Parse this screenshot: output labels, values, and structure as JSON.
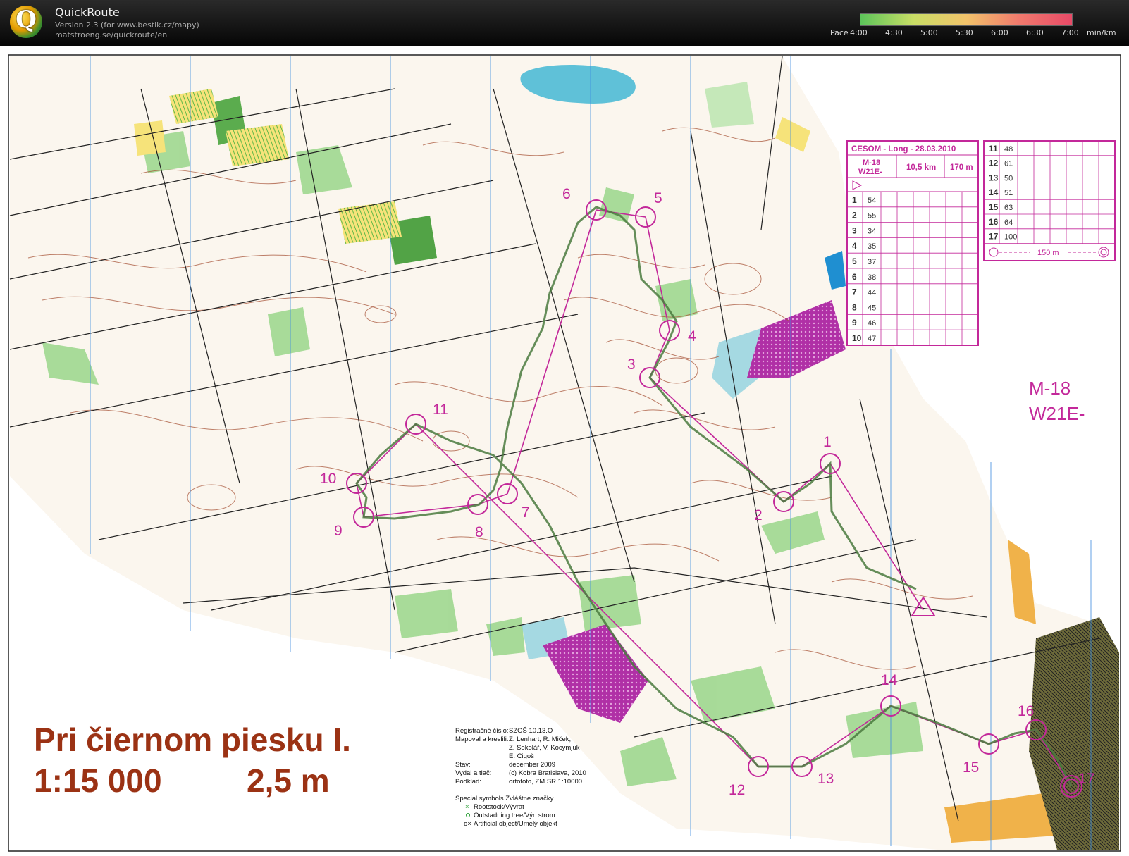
{
  "app": {
    "title": "QuickRoute",
    "version": "Version 2.3  (for www.bestik.cz/mapy)",
    "site": "matstroeng.se/quickroute/en",
    "logo_letter": "Q"
  },
  "pace_legend": {
    "prefix": "Pace",
    "ticks": [
      "4:00",
      "4:30",
      "5:00",
      "5:30",
      "6:00",
      "6:30",
      "7:00"
    ],
    "unit": "min/km",
    "values": [
      4.0,
      4.5,
      5.0,
      5.5,
      6.0,
      6.5,
      7.0
    ],
    "colors": [
      "#5cc45a",
      "#c9de66",
      "#f2c36b",
      "#f07a6d",
      "#e84a67"
    ]
  },
  "map": {
    "title": "Pri čiernom piesku I.",
    "scale": "1:15 000",
    "contour": "2,5 m",
    "course_class_line1": "M-18",
    "course_class_line2": "W21E-",
    "colors": {
      "course": "#c3289a",
      "route": "#4a7a3e",
      "contour": "#a8553a",
      "water": "#5fc1d8",
      "vegetation": "#5fb848",
      "open": "#f6e37a",
      "purple": "#b030a6",
      "grid": "#3d8ce0"
    }
  },
  "control_descriptions": {
    "header": "CESOM - Long - 28.03.2010",
    "class_1": "M-18",
    "class_2": "W21E-",
    "length": "10,5 km",
    "climb": "170 m",
    "rows": [
      {
        "num": "1",
        "code": "54"
      },
      {
        "num": "2",
        "code": "55"
      },
      {
        "num": "3",
        "code": "34"
      },
      {
        "num": "4",
        "code": "35"
      },
      {
        "num": "5",
        "code": "37"
      },
      {
        "num": "6",
        "code": "38"
      },
      {
        "num": "7",
        "code": "44"
      },
      {
        "num": "8",
        "code": "45"
      },
      {
        "num": "9",
        "code": "46"
      },
      {
        "num": "10",
        "code": "47"
      },
      {
        "num": "11",
        "code": "48"
      },
      {
        "num": "12",
        "code": "61"
      },
      {
        "num": "13",
        "code": "50"
      },
      {
        "num": "14",
        "code": "51"
      },
      {
        "num": "15",
        "code": "63"
      },
      {
        "num": "16",
        "code": "64"
      },
      {
        "num": "17",
        "code": "100"
      }
    ],
    "finish_distance": "150 m"
  },
  "imprint": {
    "lines": [
      {
        "label": "Registračné číslo:",
        "value": "SZOŠ 10.13.O"
      },
      {
        "label": "Mapoval a kreslili:",
        "value": "Z. Lenhart, R. Miček,"
      },
      {
        "label": "",
        "value": "Z. Sokolář, V. Kocymjuk"
      },
      {
        "label": "",
        "value": "E. Cigoš"
      },
      {
        "label": "Stav:",
        "value": "december 2009"
      },
      {
        "label": "Vydal a tlač:",
        "value": "(c) Kobra Bratislava, 2010"
      },
      {
        "label": "Podklad:",
        "value": "ortofoto, ZM SR 1:10000"
      }
    ],
    "special_title": "Special symbols    Zvláštne značky",
    "special_items": [
      "Rootstock/Vývrat",
      "Outstadning tree/Výr. strom",
      "Artificial object/Umelý objekt"
    ]
  },
  "controls": [
    {
      "num": "1"
    },
    {
      "num": "2"
    },
    {
      "num": "3"
    },
    {
      "num": "4"
    },
    {
      "num": "5"
    },
    {
      "num": "6"
    },
    {
      "num": "7"
    },
    {
      "num": "8"
    },
    {
      "num": "9"
    },
    {
      "num": "10"
    },
    {
      "num": "11"
    },
    {
      "num": "12"
    },
    {
      "num": "13"
    },
    {
      "num": "14"
    },
    {
      "num": "15"
    },
    {
      "num": "16"
    },
    {
      "num": "17"
    }
  ]
}
